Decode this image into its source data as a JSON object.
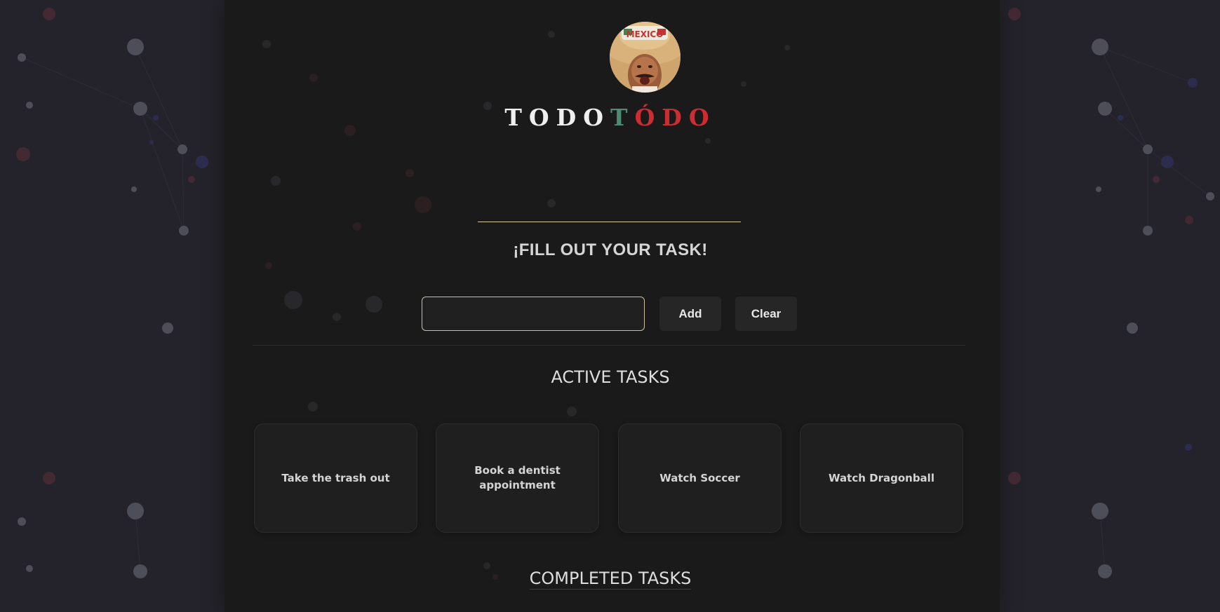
{
  "brand": {
    "part1": "TODO",
    "part2": "T",
    "part3": "ÓDO"
  },
  "avatar": {
    "hat_text": "MEXICO"
  },
  "form": {
    "prompt": "¡FILL OUT YOUR TASK!",
    "input_value": "",
    "input_placeholder": "",
    "add_label": "Add",
    "clear_label": "Clear"
  },
  "sections": {
    "active_title": "ACTIVE TASKS",
    "completed_title": "COMPLETED TASKS"
  },
  "tasks": {
    "active": [
      "Take the trash out",
      "Book a dentist appointment",
      "Watch Soccer",
      "Watch Dragonball"
    ]
  },
  "colors": {
    "background": "#24232b",
    "panel": "#1a1a1b",
    "brand_white": "#efefef",
    "brand_green": "#4f8a74",
    "brand_red": "#cd2c32",
    "input_border": "#cdbf9d"
  }
}
